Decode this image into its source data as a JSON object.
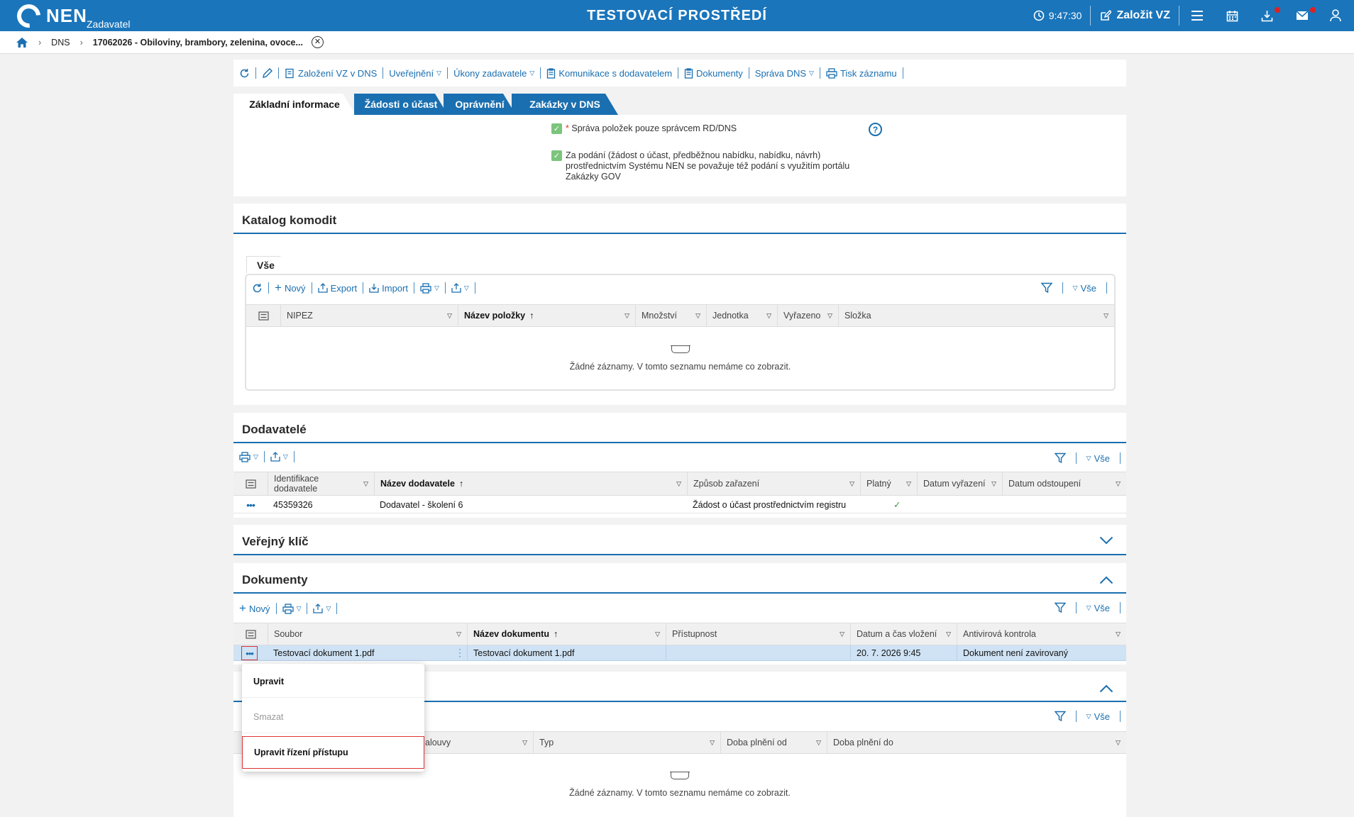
{
  "topbar": {
    "logo": "NEN",
    "role": "Zadavatel",
    "env_title": "TESTOVACÍ PROSTŘEDÍ",
    "time": "9:47:30",
    "create_label": "Založit VZ"
  },
  "breadcrumb": {
    "items": [
      "DNS",
      "17062026 - Obiloviny, brambory, zelenina, ovoce..."
    ]
  },
  "actions": {
    "items": [
      "Založení VZ v DNS",
      "Uveřejnění",
      "Úkony zadavatele",
      "Komunikace s dodavatelem",
      "Dokumenty",
      "Správa DNS",
      "Tisk záznamu"
    ]
  },
  "tabs": [
    "Základní informace",
    "Žádosti o účast",
    "Oprávnění",
    "Zakázky v DNS"
  ],
  "basic": {
    "check1_star": "*",
    "check1": "Správa položek pouze správcem RD/DNS",
    "check2_l1": "Za podání (žádost o účast, předběžnou nabídku, nabídku, návrh)",
    "check2_l2": "prostřednictvím Systému NEN se považuje též podání s využitím portálu",
    "check2_l3": "Zakázky GOV",
    "help": "?"
  },
  "catalog": {
    "title": "Katalog komodit",
    "subtab": "Vše",
    "tools": {
      "new": "Nový",
      "export": "Export",
      "import": "Import"
    },
    "filter_label": "Vše",
    "columns": [
      "NIPEZ",
      "Název položky",
      "Množství",
      "Jednotka",
      "Vyřazeno",
      "Složka"
    ],
    "empty": "Žádné záznamy. V tomto seznamu nemáme co zobrazit."
  },
  "suppliers": {
    "title": "Dodavatelé",
    "filter_label": "Vše",
    "columns": [
      "Identifikace dodavatele",
      "Název dodavatele",
      "Způsob zařazení",
      "Platný",
      "Datum vyřazení",
      "Datum odstoupení"
    ],
    "col0_l1": "Identifikace",
    "col0_l2": "dodavatele",
    "row": {
      "id": "45359326",
      "name": "Dodavatel - školení 6",
      "method": "Žádost o účast prostřednictvím registru",
      "valid": "✓"
    }
  },
  "public_key": {
    "title": "Veřejný klíč"
  },
  "documents": {
    "title": "Dokumenty",
    "new_label": "Nový",
    "filter_label": "Vše",
    "columns": [
      "Soubor",
      "Název dokumentu",
      "Přístupnost",
      "Datum a čas vložení",
      "Antivirová kontrola"
    ],
    "row": {
      "file": "Testovací dokument 1.pdf",
      "name": "Testovací dokument 1.pdf",
      "access": "",
      "date": "20. 7. 2026 9:45",
      "av": "Dokument není zavirovaný"
    }
  },
  "contracts": {
    "filter_label": "Vše",
    "columns": [
      "alouvy",
      "Typ",
      "Doba plnění od",
      "Doba plnění do"
    ],
    "empty": "Žádné záznamy. V tomto seznamu nemáme co zobrazit."
  },
  "context_menu": {
    "items": [
      "Upravit",
      "Smazat",
      "Upravit řízení přístupu"
    ]
  },
  "colors": {
    "primary": "#1a75bb",
    "link": "#1a6fb0",
    "check": "#7cc47c",
    "highlight": "#d33333",
    "selected_row": "#cfe3f5"
  }
}
